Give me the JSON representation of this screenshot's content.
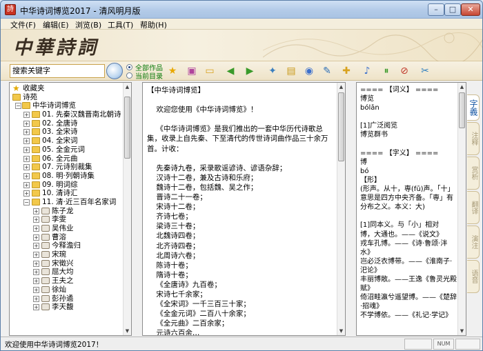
{
  "window": {
    "title": "中华诗词博览2017 - 清风明月版",
    "app_icon_glyph": "詩",
    "minimize": "–",
    "maximize": "□",
    "close": "✕"
  },
  "menu": [
    "文件(F)",
    "编辑(E)",
    "浏览(B)",
    "工具(T)",
    "帮助(H)"
  ],
  "banner": {
    "logo": "中華詩詞"
  },
  "toolbar": {
    "search_value": "搜索关键字",
    "radio_all": "全部作品",
    "radio_current": "当前目录",
    "radio_selected": "全部作品",
    "buttons": [
      {
        "icon": "star-icon",
        "glyph": "★",
        "color": "#e8a800"
      },
      {
        "icon": "book-icon",
        "glyph": "▣",
        "color": "#b0449c"
      },
      {
        "icon": "folder-open-icon",
        "glyph": "▭",
        "color": "#d8a21e"
      },
      {
        "icon": "arrow-left-icon",
        "glyph": "◀",
        "color": "#3a9a2a"
      },
      {
        "icon": "arrow-right-icon",
        "glyph": "▶",
        "color": "#3a9a2a"
      },
      {
        "icon": "fish-icon",
        "glyph": "✦",
        "color": "#3b7fbf"
      },
      {
        "icon": "lock-icon",
        "glyph": "▤",
        "color": "#c99a1a"
      },
      {
        "icon": "cycle-icon",
        "glyph": "◉",
        "color": "#3b6fcc"
      },
      {
        "icon": "edit-icon",
        "glyph": "✎",
        "color": "#2e6fb7"
      },
      {
        "icon": "folder-star-icon",
        "glyph": "✚",
        "color": "#d8a21e"
      },
      {
        "icon": "music-icon",
        "glyph": "♪",
        "color": "#3b6fcc"
      },
      {
        "icon": "pause-icon",
        "glyph": "⏸",
        "color": "#3a9a2a"
      },
      {
        "icon": "stop-sound-icon",
        "glyph": "⊘",
        "color": "#c0392b"
      },
      {
        "icon": "tools-icon",
        "glyph": "✂",
        "color": "#2e7fbf"
      }
    ]
  },
  "tree": {
    "items": [
      {
        "level": 0,
        "label": "收藏夹",
        "icon": "star-icon",
        "expander": ""
      },
      {
        "level": 0,
        "label": "诗苑",
        "icon": "folder-icon",
        "expander": ""
      },
      {
        "level": 0,
        "label": "中华诗词博览",
        "icon": "folder-icon",
        "expander": "−"
      },
      {
        "level": 1,
        "label": "01. 先秦汉魏晋南北朝诗",
        "icon": "folder-icon",
        "expander": "+"
      },
      {
        "level": 1,
        "label": "02. 全唐诗",
        "icon": "folder-icon",
        "expander": "+"
      },
      {
        "level": 1,
        "label": "03. 全宋诗",
        "icon": "folder-icon",
        "expander": "+"
      },
      {
        "level": 1,
        "label": "04. 全宋词",
        "icon": "folder-icon",
        "expander": "+"
      },
      {
        "level": 1,
        "label": "05. 全金元词",
        "icon": "folder-icon",
        "expander": "+"
      },
      {
        "level": 1,
        "label": "06. 全元曲",
        "icon": "folder-icon",
        "expander": "+"
      },
      {
        "level": 1,
        "label": "07. 元诗别裁集",
        "icon": "folder-icon",
        "expander": "+"
      },
      {
        "level": 1,
        "label": "08. 明·列朝诗集",
        "icon": "folder-icon",
        "expander": "+"
      },
      {
        "level": 1,
        "label": "09. 明词综",
        "icon": "folder-icon",
        "expander": "+"
      },
      {
        "level": 1,
        "label": "10. 清诗汇",
        "icon": "folder-icon",
        "expander": "+"
      },
      {
        "level": 1,
        "label": "11. 清·近三百年名家词",
        "icon": "folder-icon",
        "expander": "−"
      },
      {
        "level": 2,
        "label": "陈子龙",
        "icon": "book-icon",
        "expander": "+"
      },
      {
        "level": 2,
        "label": "李雯",
        "icon": "book-icon",
        "expander": "+"
      },
      {
        "level": 2,
        "label": "吴伟业",
        "icon": "book-icon",
        "expander": "+"
      },
      {
        "level": 2,
        "label": "曹溶",
        "icon": "book-icon",
        "expander": "+"
      },
      {
        "level": 2,
        "label": "今释澹归",
        "icon": "book-icon",
        "expander": "+"
      },
      {
        "level": 2,
        "label": "宋琬",
        "icon": "book-icon",
        "expander": "+"
      },
      {
        "level": 2,
        "label": "宋徵兴",
        "icon": "book-icon",
        "expander": "+"
      },
      {
        "level": 2,
        "label": "屈大均",
        "icon": "book-icon",
        "expander": "+"
      },
      {
        "level": 2,
        "label": "王夫之",
        "icon": "book-icon",
        "expander": "+"
      },
      {
        "level": 2,
        "label": "徐灿",
        "icon": "book-icon",
        "expander": "+"
      },
      {
        "level": 2,
        "label": "彭孙遹",
        "icon": "book-icon",
        "expander": "+"
      },
      {
        "level": 2,
        "label": "李天馥",
        "icon": "book-icon",
        "expander": "+"
      }
    ]
  },
  "middle_text": "【中华诗词博览】\n\n    欢迎您使用《中华诗词博览》！\n\n    《中华诗词博览》是我们推出的一套中华历代诗歌总\n集，收录上自先秦、下至清代的传世诗词曲作品三十余万\n首。计收：\n\n    先秦诗九卷，采录歌谣谚诗、谚语杂辞；\n    汉诗十二卷，兼及古诗和乐府；\n    魏诗十二卷，包括魏、吴之作；\n    晋诗二十一卷；\n    宋诗十二卷；\n    齐诗七卷；\n    梁诗三十卷；\n    北魏诗四卷；\n    北齐诗四卷；\n    北周诗六卷；\n    陈诗十卷；\n    隋诗十卷；\n    《全唐诗》九百卷；\n    宋诗七千余家；\n    《全宋词》一千三百三十家；\n    《全金元词》二百八十余家；\n    《全元曲》二百余家；\n    元诗六百余…",
  "definition_text": "==== 【词义】 ====\n博览\nbólǎn\n\n[1]广泛阅览\n博览群书\n\n==== 【字义】 ====\n博\nbó\n【形】\n(形声。从十，専(fū)声。「十」意思是四方中央齐备。「専」有分布之义。本义：大)\n\n[1]同本义。与「小」相对\n博，大通也。——《说文》\n戎车孔博。——《诗·鲁颂·泮水》\n岂必泛衣博带。——《淮南子·汜论》\n丰丽博敞。——王逸《鲁灵光殿赋》\n倚沼畦瀛兮遥望博。——《楚辞·招魂》\n不学博依。——《礼记·学记》",
  "side_tabs": [
    "字義",
    "注释",
    "赏析",
    "翻译",
    "演注",
    "语音"
  ],
  "status": {
    "text": "欢迎使用中华诗词博览2017！",
    "cell1": "",
    "cell2": "NUM",
    "cell3": ""
  }
}
